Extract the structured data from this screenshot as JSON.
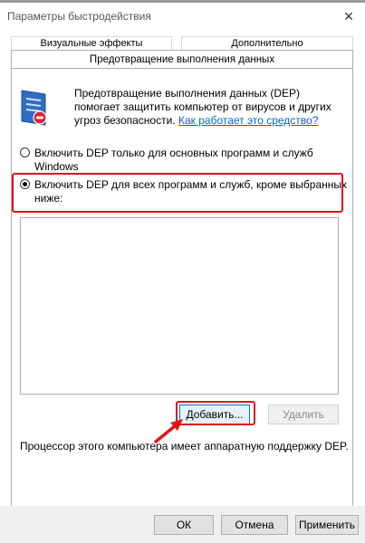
{
  "window": {
    "title": "Параметры быстродействия",
    "close_glyph": "✕"
  },
  "tabs": [
    {
      "label": "Визуальные эффекты"
    },
    {
      "label": "Дополнительно"
    },
    {
      "label": "Предотвращение выполнения данных",
      "active": true
    }
  ],
  "intro": {
    "text": "Предотвращение выполнения данных (DEP) помогает защитить компьютер от вирусов и других угроз безопасности.",
    "link": "Как работает это средство?"
  },
  "options": [
    {
      "label": "Включить DEP только для основных программ и служб Windows",
      "selected": false
    },
    {
      "label": "Включить DEP для всех программ и служб, кроме выбранных ниже:",
      "selected": true
    }
  ],
  "buttons": {
    "add": "Добавить...",
    "remove": "Удалить",
    "ok": "ОК",
    "cancel": "Отмена",
    "apply": "Применить"
  },
  "hardware_note": "Процессор этого компьютера имеет аппаратную поддержку DEP.",
  "colors": {
    "highlight": "#e0141a",
    "link": "#0066cc"
  }
}
